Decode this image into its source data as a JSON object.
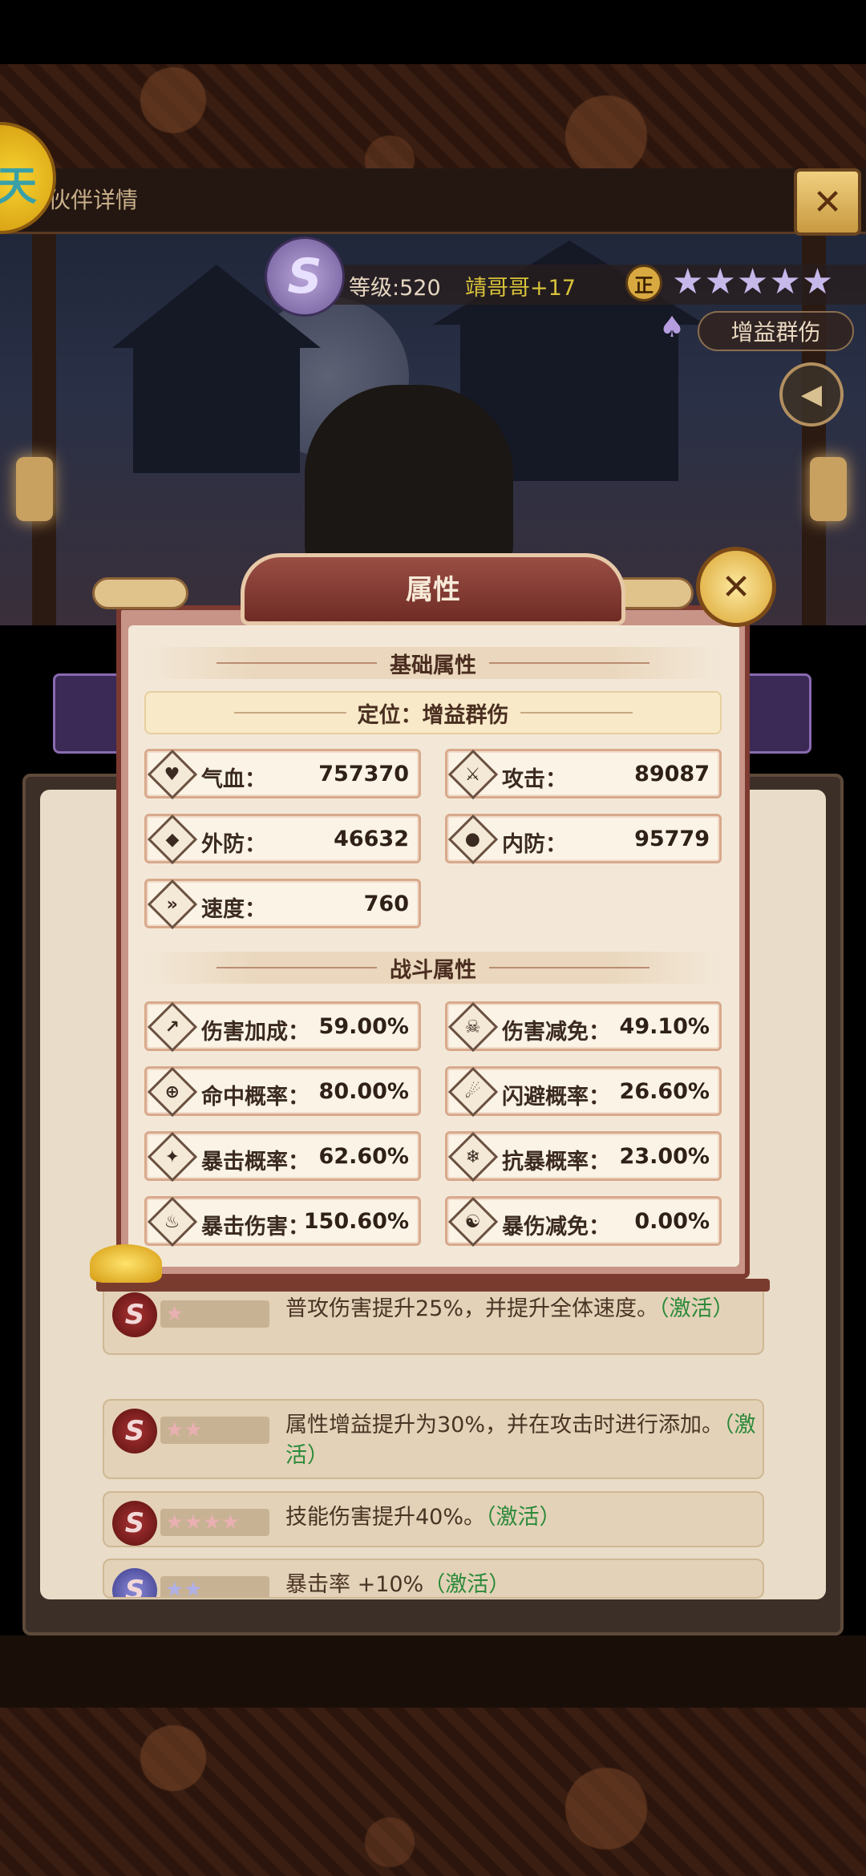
{
  "header": {
    "title_partial": "伙伴详情",
    "avatar_glyph": "天",
    "level_text": "等级:520",
    "name_text": "靖哥哥+17",
    "rank_glyph": "正",
    "stars": "★★★★★",
    "star_count": 5,
    "role_tag": "增益群伤",
    "close_glyph": "✕",
    "sound_glyph": "◀"
  },
  "panel": {
    "title": "属性",
    "close_glyph": "✕",
    "basic_section": "基础属性",
    "role_line": "定位：增益群伤",
    "combat_section": "战斗属性",
    "basic_stats": [
      {
        "icon": "heart-icon",
        "glyph": "♥",
        "label": "气血：",
        "value": "757370"
      },
      {
        "icon": "sword-icon",
        "glyph": "⚔",
        "label": "攻击：",
        "value": "89087"
      },
      {
        "icon": "shield-icon",
        "glyph": "◆",
        "label": "外防：",
        "value": "46632"
      },
      {
        "icon": "flame-shield-icon",
        "glyph": "●",
        "label": "内防：",
        "value": "95779"
      },
      {
        "icon": "wing-icon",
        "glyph": "»",
        "label": "速度：",
        "value": "760"
      }
    ],
    "combat_stats": [
      {
        "icon": "damage-up-icon",
        "glyph": "↗",
        "label": "伤害加成：",
        "value": "59.00%"
      },
      {
        "icon": "skull-icon",
        "glyph": "☠",
        "label": "伤害减免：",
        "value": "49.10%"
      },
      {
        "icon": "crosshair-icon",
        "glyph": "⊕",
        "label": "命中概率：",
        "value": "80.00%"
      },
      {
        "icon": "dodge-icon",
        "glyph": "☄",
        "label": "闪避概率：",
        "value": "26.60%"
      },
      {
        "icon": "crit-icon",
        "glyph": "✦",
        "label": "暴击概率：",
        "value": "62.60%"
      },
      {
        "icon": "anti-crit-icon",
        "glyph": "❄",
        "label": "抗暴概率：",
        "value": "23.00%"
      },
      {
        "icon": "crit-damage-icon",
        "glyph": "♨",
        "label": "暴击伤害：",
        "value": "150.60%"
      },
      {
        "icon": "crit-reduce-icon",
        "glyph": "☯",
        "label": "暴伤减免：",
        "value": "0.00%"
      }
    ]
  },
  "skills": [
    {
      "stars": "★",
      "text": "普攻伤害提升25%，并提升全体速度。",
      "activate": "（激活）"
    },
    {
      "stars": "★★",
      "text": "属性增益提升为30%，并在攻击时进行添加。",
      "activate": "（激活）"
    },
    {
      "stars": "★★★★",
      "text": "技能伤害提升40%。",
      "activate": "（激活）"
    },
    {
      "stars": "★★",
      "text": "暴击率 +10%",
      "activate": "（激活）"
    }
  ],
  "colors": {
    "panel_frame": "#7c3a30",
    "panel_bg": "#f3e8d8",
    "activate_green": "#2c8a3a",
    "star_purple": "#c7b8ea"
  }
}
